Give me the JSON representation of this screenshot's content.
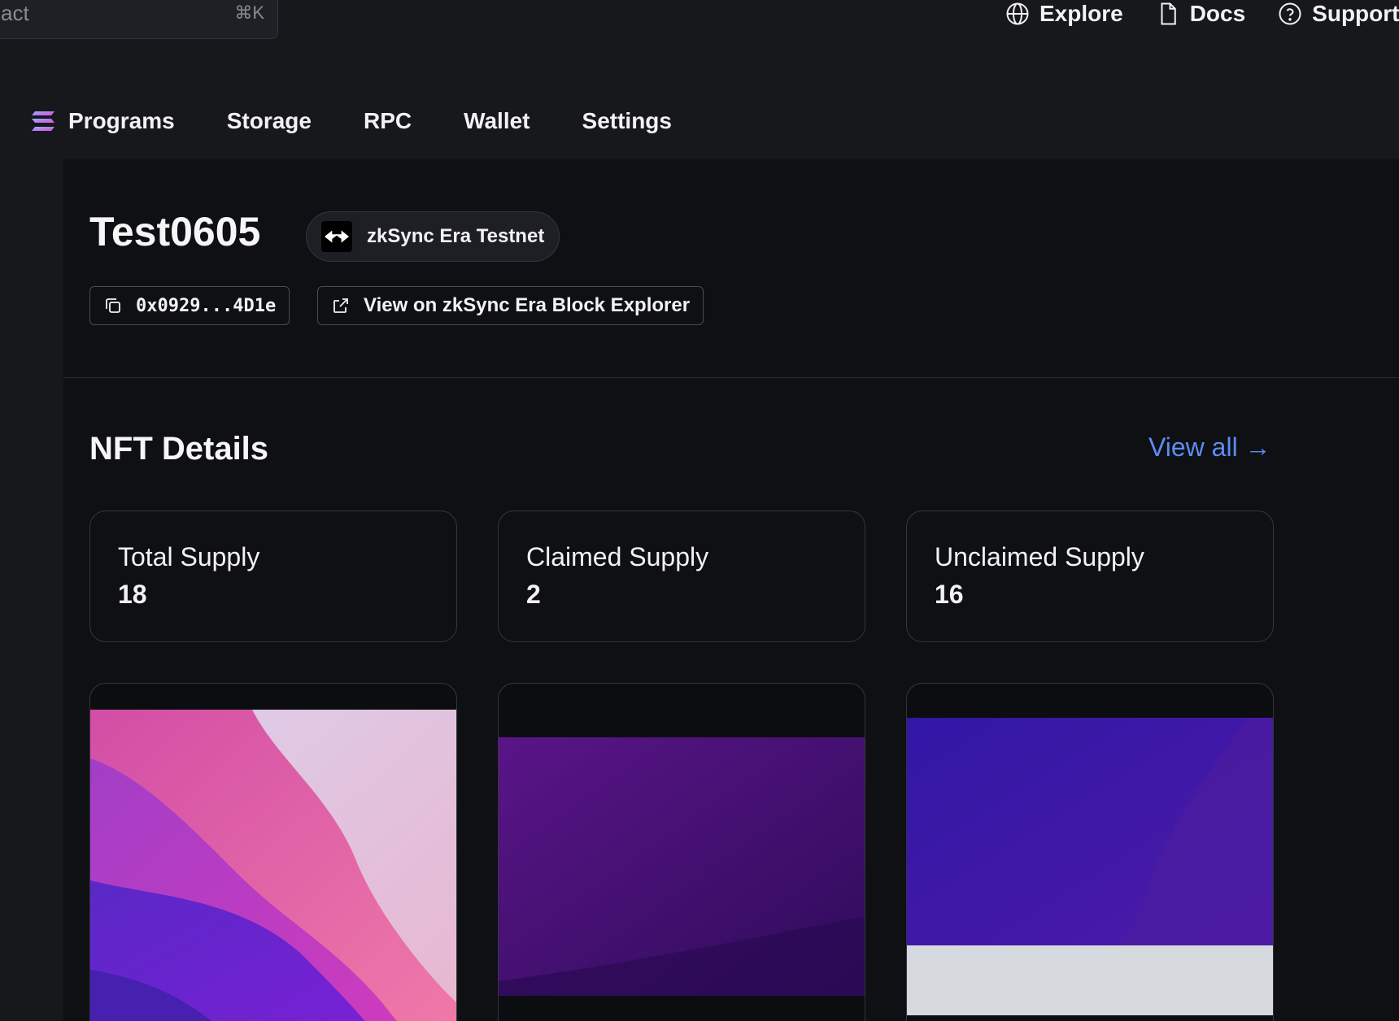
{
  "header": {
    "search": {
      "placeholder": "act",
      "shortcut": "⌘K"
    },
    "links": [
      {
        "label": "Explore",
        "icon": "globe-icon"
      },
      {
        "label": "Docs",
        "icon": "document-icon"
      },
      {
        "label": "Support",
        "icon": "help-circle-icon"
      }
    ]
  },
  "nav": {
    "logo_icon": "solana-logo-icon",
    "items": [
      "Programs",
      "Storage",
      "RPC",
      "Wallet",
      "Settings"
    ]
  },
  "contract": {
    "title": "Test0605",
    "network": {
      "name": "zkSync Era Testnet",
      "icon": "zksync-logo-icon"
    },
    "address": "0x0929...4D1e",
    "explorer_label": "View on zkSync Era Block Explorer"
  },
  "nft_details": {
    "title": "NFT Details",
    "view_all": "View all →",
    "stats": [
      {
        "label": "Total Supply",
        "value": "18"
      },
      {
        "label": "Claimed Supply",
        "value": "2"
      },
      {
        "label": "Unclaimed Supply",
        "value": "16"
      }
    ]
  },
  "colors": {
    "background": "#17181c",
    "panel": "#0f1013",
    "accent_link": "#5b8df5",
    "border": "#34363d"
  }
}
